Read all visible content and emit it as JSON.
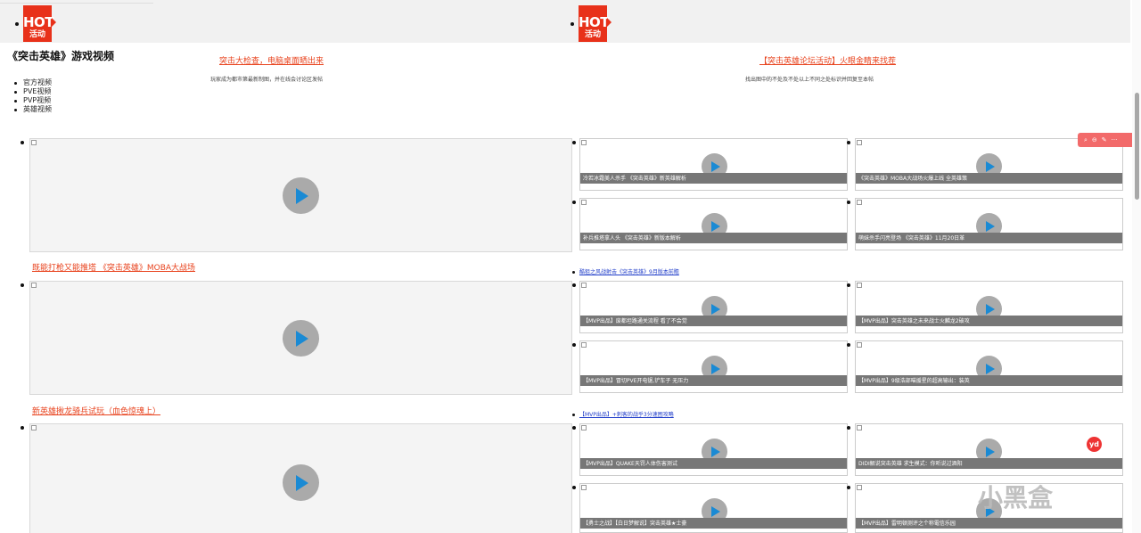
{
  "hot_badge": {
    "line1": "HOT",
    "line2": "活动"
  },
  "section_title": "《突击英雄》游戏视频",
  "categories": [
    "官方视频",
    "PVE视频",
    "PVP视频",
    "英雄视频"
  ],
  "promos": [
    {
      "title": "突击大检查，电脑桌面晒出来",
      "subtitle": "玩家成为都市第最新制图，并在线会讨论区发帖"
    },
    {
      "title": "【突击英雄论坛活动】火眼金睛来找茬",
      "subtitle": "找出图中的不处及不处以上不同之处标识并回复至本帖"
    }
  ],
  "big_videos": [
    {
      "caption": "既能打枪又能推塔 《突击英雄》MOBA大战场"
    },
    {
      "caption": "新英雄揪龙骑兵试玩（血色惊魂上）"
    },
    {
      "caption": ""
    }
  ],
  "small_videos": [
    {
      "caption": "冷若冰霜美人杀手 《突击英雄》新英雄解析"
    },
    {
      "caption": "《突击英雄》MOBA大战场火爆上线 全英雄策"
    },
    {
      "caption": "补兵推塔拿人头 《突击英雄》新版本解析"
    },
    {
      "caption": "萌妹杀手闪亮登场 《突击英雄》11月20日革"
    },
    {
      "caption": "【MVP出品】废都坦路通关流程 看了不会觉"
    },
    {
      "caption": "【MVP出品】突击英雄之未来战士火麟龙2破攻"
    },
    {
      "caption": "【MVP出品】冒切PVE开电锯,铲车子 无压力"
    },
    {
      "caption": "【MVP出品】9级浩部喵援星的超高输出：装英"
    },
    {
      "caption": "【MVP出品】QUAKE天罚人体伤害测试"
    },
    {
      "caption": "DIDI解说突击英雄 求生模式：你听说过酒阳"
    },
    {
      "caption": "【勇士之战】【白日梦解说】突击英雄★士豪"
    },
    {
      "caption": "【MVP出品】雷明顿测评之个称電信乐园"
    }
  ],
  "blue_links": [
    "酷狙之风战射击《突击英雄》9月版本前瞻",
    "【MVP出品】+刺客的战乎3分速囿攻略"
  ],
  "toolbar_icons": [
    "search-icon",
    "minus-circle-icon",
    "pen-icon",
    "more-icon"
  ],
  "toolbar_labels": {
    "search": "⌕",
    "minus": "⊖",
    "pen": "✎",
    "more": "···"
  },
  "watermark": "小黑盒",
  "floating_badge": "yd",
  "colors": {
    "accent": "#e8311a",
    "link": "#e8431e",
    "blue_link": "#1f3cc9",
    "play": "#1a8ad4"
  }
}
